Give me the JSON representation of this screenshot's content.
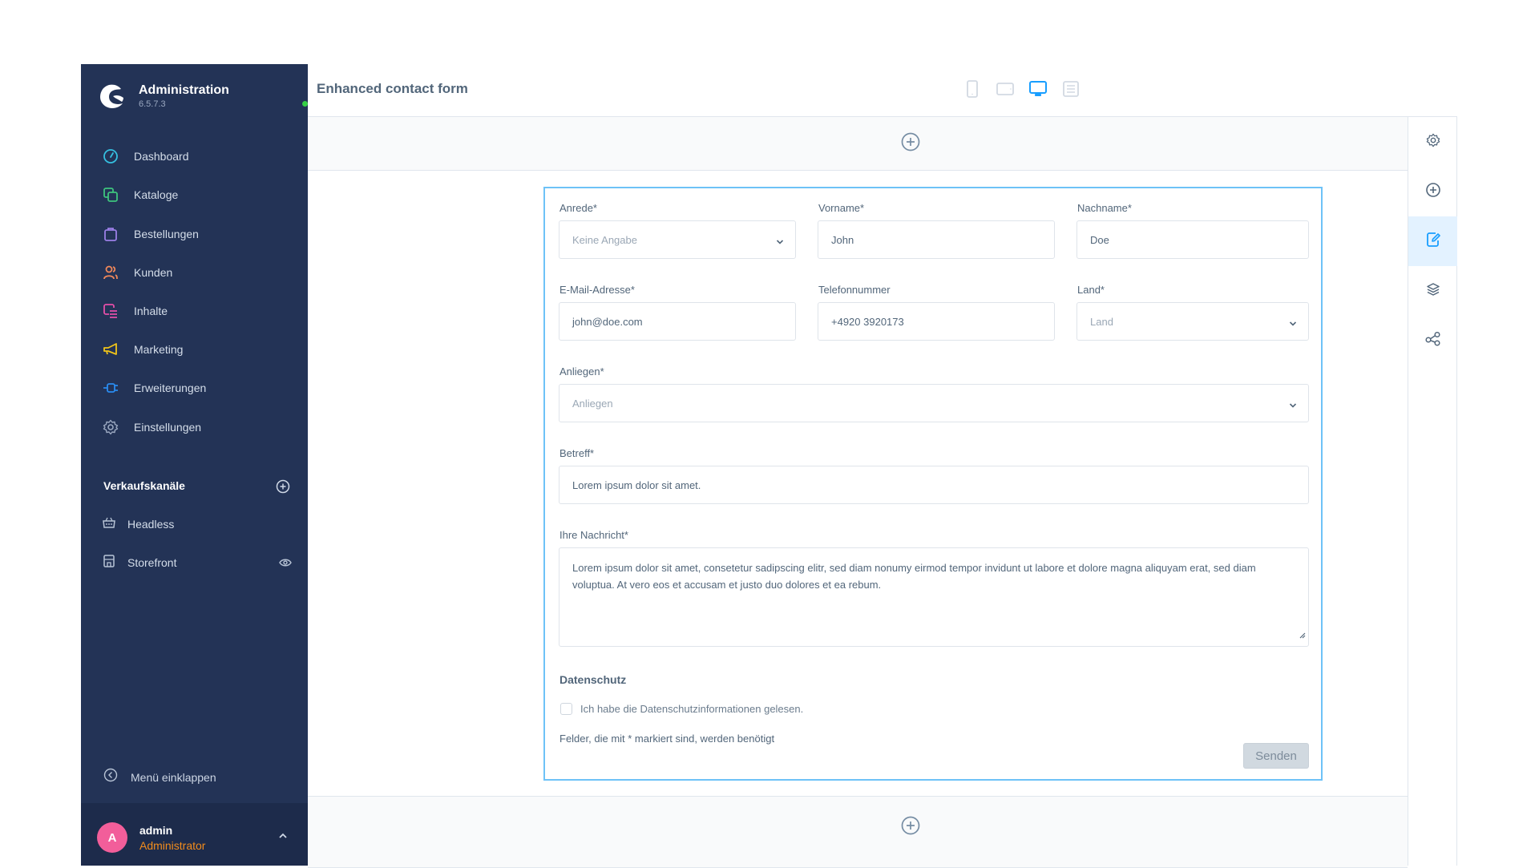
{
  "sidebar": {
    "brand_title": "Administration",
    "brand_version": "6.5.7.3",
    "status_color": "#37d046",
    "items": [
      {
        "label": "Dashboard",
        "icon": "gauge-icon",
        "color": "#35c0e0"
      },
      {
        "label": "Kataloge",
        "icon": "copy-icon",
        "color": "#3ec47e"
      },
      {
        "label": "Bestellungen",
        "icon": "shopping-bag-icon",
        "color": "#9b7fe6"
      },
      {
        "label": "Kunden",
        "icon": "users-icon",
        "color": "#f0885a"
      },
      {
        "label": "Inhalte",
        "icon": "content-icon",
        "color": "#e44fa8"
      },
      {
        "label": "Marketing",
        "icon": "megaphone-icon",
        "color": "#f0c419"
      },
      {
        "label": "Erweiterungen",
        "icon": "plug-icon",
        "color": "#2a8cf0"
      },
      {
        "label": "Einstellungen",
        "icon": "gear-icon",
        "color": "#9aa8c0"
      }
    ],
    "sales_channels_title": "Verkaufskanäle",
    "channels": [
      {
        "label": "Headless",
        "icon": "basket-icon"
      },
      {
        "label": "Storefront",
        "icon": "storefront-icon",
        "trailing_icon": "eye-icon"
      }
    ],
    "collapse_label": "Menü einklappen",
    "user": {
      "initial": "A",
      "name": "admin",
      "role": "Administrator"
    }
  },
  "header": {
    "title": "Enhanced contact form",
    "devices": [
      {
        "name": "mobile",
        "active": false
      },
      {
        "name": "tablet",
        "active": false
      },
      {
        "name": "desktop",
        "active": true
      },
      {
        "name": "list",
        "active": false
      }
    ]
  },
  "form": {
    "anrede": {
      "label": "Anrede*",
      "value": "Keine Angabe"
    },
    "vorname": {
      "label": "Vorname*",
      "value": "John"
    },
    "nachname": {
      "label": "Nachname*",
      "value": "Doe"
    },
    "email": {
      "label": "E-Mail-Adresse*",
      "value": "john@doe.com"
    },
    "telefon": {
      "label": "Telefonnummer",
      "value": "+4920 3920173"
    },
    "land": {
      "label": "Land*",
      "placeholder": "Land"
    },
    "anliegen": {
      "label": "Anliegen*",
      "placeholder": "Anliegen"
    },
    "betreff": {
      "label": "Betreff*",
      "value": "Lorem ipsum dolor sit amet."
    },
    "nachricht": {
      "label": "Ihre Nachricht*",
      "value": "Lorem ipsum dolor sit amet, consetetur sadipscing elitr, sed diam nonumy eirmod tempor invidunt ut labore et dolore magna aliquyam erat, sed diam voluptua. At vero eos et accusam et justo duo dolores et ea rebum."
    },
    "privacy_heading": "Datenschutz",
    "privacy_checkbox_label": "Ich habe die Datenschutzinformationen gelesen.",
    "privacy_checked": false,
    "required_note": "Felder, die mit * markiert sind, werden benötigt",
    "submit_label": "Senden"
  },
  "right_panel": {
    "items": [
      {
        "name": "settings",
        "active": false
      },
      {
        "name": "add-block",
        "active": false
      },
      {
        "name": "edit-content",
        "active": true
      },
      {
        "name": "layers",
        "active": false
      },
      {
        "name": "share",
        "active": false
      }
    ]
  },
  "colors": {
    "sidebar_bg": "#233356",
    "accent": "#189eff",
    "frame_border": "#6ec2f7"
  }
}
